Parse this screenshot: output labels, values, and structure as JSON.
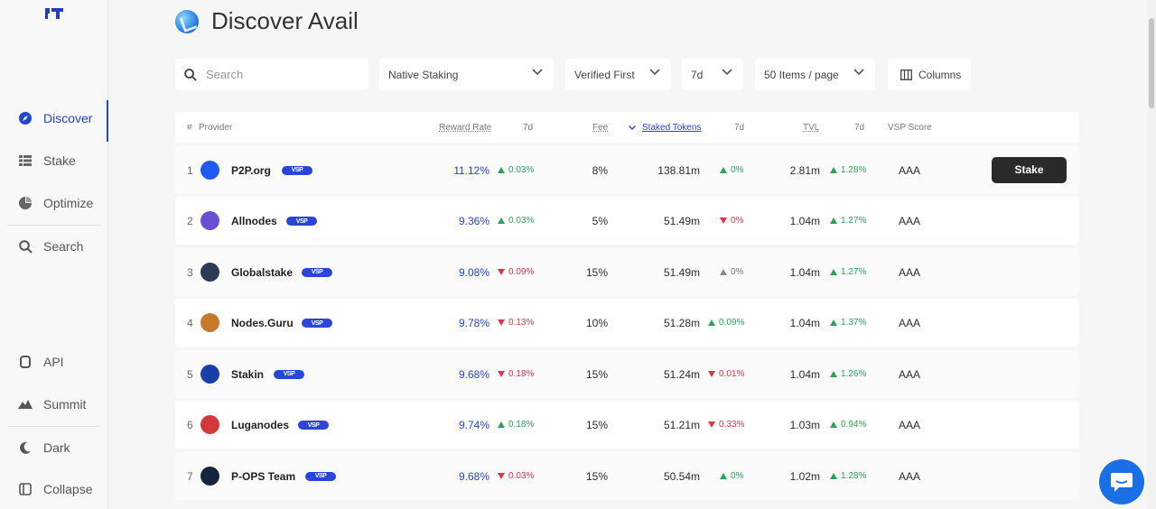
{
  "sidebar": {
    "items": [
      {
        "label": "Discover",
        "icon": "compass-icon"
      },
      {
        "label": "Stake",
        "icon": "list-icon"
      },
      {
        "label": "Optimize",
        "icon": "pie-icon"
      },
      {
        "label": "Search",
        "icon": "search-icon"
      },
      {
        "label": "API",
        "icon": "api-icon"
      },
      {
        "label": "Summit",
        "icon": "mountain-icon"
      },
      {
        "label": "Dark",
        "icon": "moon-icon"
      },
      {
        "label": "Collapse",
        "icon": "collapse-icon"
      }
    ]
  },
  "header": {
    "title": "Discover Avail"
  },
  "filters": {
    "search_placeholder": "Search",
    "staking_type": "Native Staking",
    "sort": "Verified First",
    "period": "7d",
    "page_size": "50 Items / page",
    "columns_label": "Columns"
  },
  "table": {
    "headers": {
      "rank": "#",
      "provider": "Provider",
      "reward_rate": "Reward Rate",
      "reward_period": "7d",
      "fee": "Fee",
      "staked_tokens": "Staked Tokens",
      "staked_period": "7d",
      "tvl": "TVL",
      "tvl_period": "7d",
      "vsp_score": "VSP Score"
    },
    "rows": [
      {
        "rank": "1",
        "name": "P2P.org",
        "reward": "11.12%",
        "reward_chg": "0.03%",
        "reward_dir": "up",
        "fee": "8%",
        "staked": "138.81m",
        "staked_chg": "0%",
        "staked_dir": "up",
        "tvl": "2.81m",
        "tvl_chg": "1.28%",
        "tvl_dir": "up",
        "vsp": "AAA",
        "action": "Stake",
        "logo_color": "#1f5bf0"
      },
      {
        "rank": "2",
        "name": "Allnodes",
        "reward": "9.36%",
        "reward_chg": "0.03%",
        "reward_dir": "up",
        "fee": "5%",
        "staked": "51.49m",
        "staked_chg": "0%",
        "staked_dir": "down",
        "tvl": "1.04m",
        "tvl_chg": "1.27%",
        "tvl_dir": "up",
        "vsp": "AAA",
        "logo_color": "#6a4fd6"
      },
      {
        "rank": "3",
        "name": "Globalstake",
        "reward": "9.08%",
        "reward_chg": "0.09%",
        "reward_dir": "down",
        "fee": "15%",
        "staked": "51.49m",
        "staked_chg": "0%",
        "staked_dir": "flat",
        "tvl": "1.04m",
        "tvl_chg": "1.27%",
        "tvl_dir": "up",
        "vsp": "AAA",
        "logo_color": "#2b3a55"
      },
      {
        "rank": "4",
        "name": "Nodes.Guru",
        "reward": "9.78%",
        "reward_chg": "0.13%",
        "reward_dir": "down",
        "fee": "10%",
        "staked": "51.28m",
        "staked_chg": "0.09%",
        "staked_dir": "up",
        "tvl": "1.04m",
        "tvl_chg": "1.37%",
        "tvl_dir": "up",
        "vsp": "AAA",
        "logo_color": "#c77a2a"
      },
      {
        "rank": "5",
        "name": "Stakin",
        "reward": "9.68%",
        "reward_chg": "0.18%",
        "reward_dir": "down",
        "fee": "15%",
        "staked": "51.24m",
        "staked_chg": "0.01%",
        "staked_dir": "down",
        "tvl": "1.04m",
        "tvl_chg": "1.26%",
        "tvl_dir": "up",
        "vsp": "AAA",
        "logo_color": "#1a3fa8"
      },
      {
        "rank": "6",
        "name": "Luganodes",
        "reward": "9.74%",
        "reward_chg": "0.18%",
        "reward_dir": "up",
        "fee": "15%",
        "staked": "51.21m",
        "staked_chg": "0.33%",
        "staked_dir": "down",
        "tvl": "1.03m",
        "tvl_chg": "0.94%",
        "tvl_dir": "up",
        "vsp": "AAA",
        "logo_color": "#d23a3a"
      },
      {
        "rank": "7",
        "name": "P-OPS Team",
        "reward": "9.68%",
        "reward_chg": "0.03%",
        "reward_dir": "down",
        "fee": "15%",
        "staked": "50.54m",
        "staked_chg": "0%",
        "staked_dir": "up",
        "tvl": "1.02m",
        "tvl_chg": "1.28%",
        "tvl_dir": "up",
        "vsp": "AAA",
        "logo_color": "#14243d"
      }
    ]
  },
  "badge_text": "VSP",
  "colors": {
    "accent": "#2446c9",
    "positive": "#29a35a",
    "negative": "#d9364a",
    "button_dark": "#2a2a2a",
    "chat": "#1a6ee6"
  }
}
